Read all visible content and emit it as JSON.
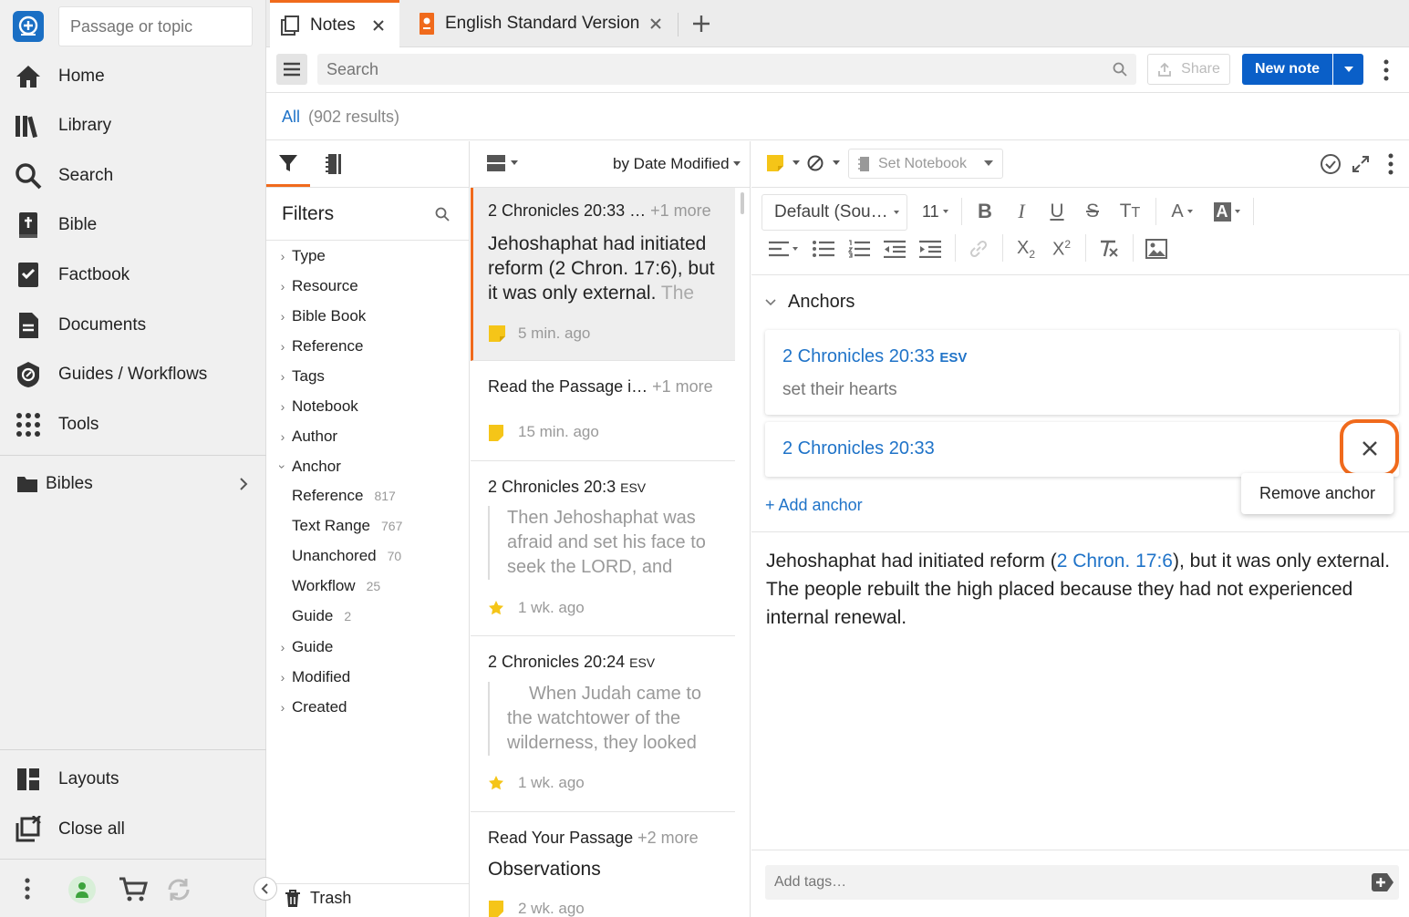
{
  "sidebar": {
    "search_placeholder": "Passage or topic",
    "nav": [
      {
        "label": "Home",
        "icon": "home-icon"
      },
      {
        "label": "Library",
        "icon": "library-icon"
      },
      {
        "label": "Search",
        "icon": "search-icon"
      },
      {
        "label": "Bible",
        "icon": "bible-icon"
      },
      {
        "label": "Factbook",
        "icon": "factbook-icon"
      },
      {
        "label": "Documents",
        "icon": "documents-icon"
      },
      {
        "label": "Guides / Workflows",
        "icon": "guides-icon"
      },
      {
        "label": "Tools",
        "icon": "tools-icon"
      }
    ],
    "bibles_label": "Bibles",
    "layouts_label": "Layouts",
    "close_all_label": "Close all"
  },
  "tabs": [
    {
      "label": "Notes",
      "active": true
    },
    {
      "label": "English Standard Version",
      "active": false
    }
  ],
  "toolbar": {
    "search_placeholder": "Search",
    "share_label": "Share",
    "new_note_label": "New note"
  },
  "results": {
    "all_label": "All",
    "count_label": "(902 results)"
  },
  "filters": {
    "title": "Filters",
    "items": [
      "Type",
      "Resource",
      "Bible Book",
      "Reference",
      "Tags",
      "Notebook",
      "Author",
      "Anchor"
    ],
    "anchor_sub": [
      {
        "label": "Reference",
        "count": "817"
      },
      {
        "label": "Text Range",
        "count": "767"
      },
      {
        "label": "Unanchored",
        "count": "70"
      },
      {
        "label": "Workflow",
        "count": "25"
      },
      {
        "label": "Guide",
        "count": "2"
      }
    ],
    "items_after": [
      "Guide",
      "Modified",
      "Created"
    ],
    "trash_label": "Trash"
  },
  "notes_list": {
    "sort_label": "by Date Modified",
    "notes": [
      {
        "ref": "2 Chronicles 20:33 …",
        "more": "+1 more",
        "body": "Jehoshaphat had initiated reform (2 Chron. 17:6), but it was only external.",
        "body_fade": "The",
        "time": "5 min. ago",
        "marker": "note"
      },
      {
        "ref": "Read the Passage i…",
        "more": "+1 more",
        "time": "15 min. ago",
        "marker": "note"
      },
      {
        "ref": "2 Chronicles 20:3",
        "version": "ESV",
        "quote": "Then Jehoshaphat was afraid and set his face to seek the LORD, and",
        "time": "1 wk. ago",
        "marker": "star"
      },
      {
        "ref": "2 Chronicles 20:24",
        "version": "ESV",
        "quote": "When Judah came to the watchtower of the wilderness, they looked",
        "time": "1 wk. ago",
        "marker": "star"
      },
      {
        "ref": "Read Your Passage",
        "more": "+2 more",
        "body": "Observations",
        "time": "2 wk. ago",
        "marker": "note"
      }
    ]
  },
  "editor": {
    "notebook_label": "Set Notebook",
    "font_label": "Default (Sou…",
    "font_size": "11",
    "anchors_title": "Anchors",
    "anchors": [
      {
        "ref": "2 Chronicles 20:33",
        "version": "ESV",
        "text": "set their hearts"
      },
      {
        "ref": "2 Chronicles 20:33"
      }
    ],
    "remove_tooltip": "Remove anchor",
    "add_anchor_label": "+ Add anchor",
    "body_pre": "Jehoshaphat had initiated reform (",
    "body_link": "2 Chron. 17:6",
    "body_post": "), but it was only external. The people rebuilt the high placed because they had not experienced internal renewal.",
    "tags_placeholder": "Add tags…"
  },
  "colors": {
    "accent": "#f06a1c",
    "link": "#1f73c8",
    "primary_button": "#0a5fc8",
    "note_marker": "#f5c518"
  }
}
